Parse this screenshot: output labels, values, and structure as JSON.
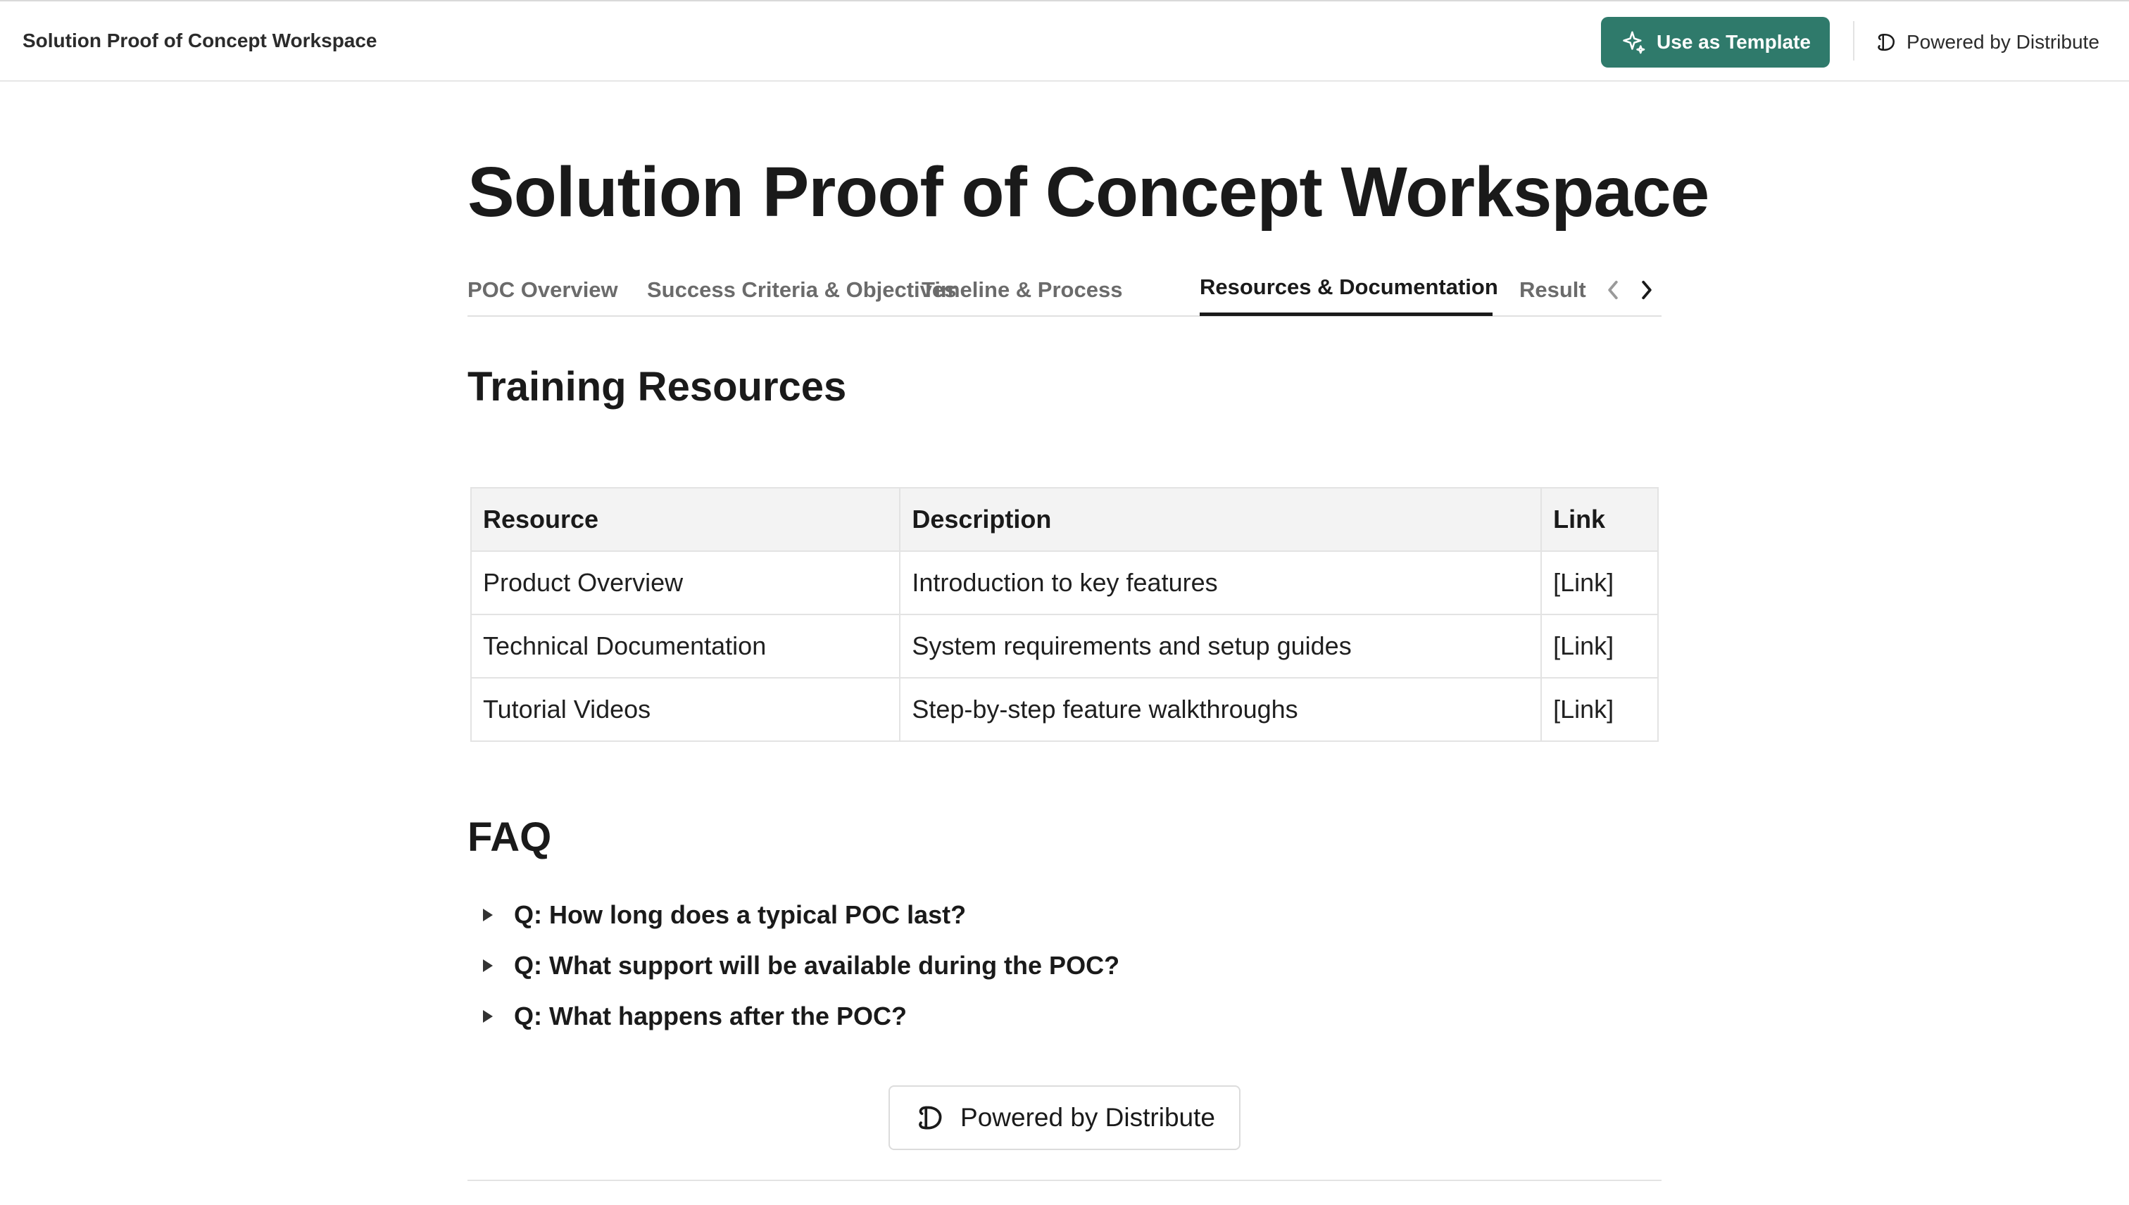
{
  "topbar": {
    "title": "Solution Proof of Concept Workspace",
    "template_button": "Use as Template",
    "powered_by": "Powered by Distribute"
  },
  "page": {
    "title": "Solution Proof of Concept Workspace"
  },
  "tabs": [
    {
      "label": "POC Overview",
      "active": false
    },
    {
      "label": "Success Criteria & Objectives",
      "active": false
    },
    {
      "label": "Timeline & Process",
      "active": false
    },
    {
      "label": "Resources & Documentation",
      "active": true
    },
    {
      "label": "Result",
      "active": false
    }
  ],
  "training": {
    "heading": "Training Resources",
    "columns": [
      "Resource",
      "Description",
      "Link"
    ],
    "rows": [
      [
        "Product Overview",
        "Introduction to key features",
        "[Link]"
      ],
      [
        "Technical Documentation",
        "System requirements and setup guides",
        "[Link]"
      ],
      [
        "Tutorial Videos",
        "Step-by-step feature walkthroughs",
        "[Link]"
      ]
    ]
  },
  "faq": {
    "heading": "FAQ",
    "items": [
      "Q: How long does a typical POC last?",
      "Q: What support will be available during the POC?",
      "Q: What happens after the POC?"
    ]
  },
  "footer": {
    "powered_by": "Powered by Distribute"
  },
  "colors": {
    "accent": "#2f7a6b",
    "text": "#1a1a1a",
    "muted_tab": "#6b6b6b"
  }
}
